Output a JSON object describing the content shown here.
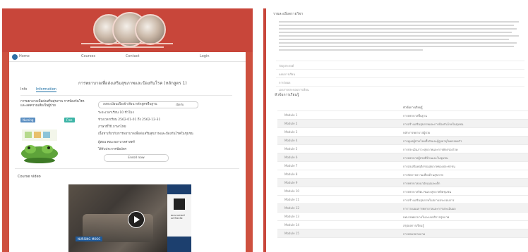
{
  "course_page": {
    "nav": [
      "Home",
      "Courses",
      "Contact",
      "Login"
    ],
    "title": "การพยาบาลเพื่อส่งเสริมสุขภาพและป้องกันโรค (หลักสูตร 1)",
    "tabs": [
      "Info",
      "Information"
    ],
    "course_title": "การพยาบาลเพื่อส่งเสริมสุขภาพ การป้องกันโรคและลดความเสี่ยงในผู้ป่วย",
    "tag_left": "Nursing",
    "tag_right": "Free",
    "info_button": "ลงทะเบียนเพื่อเข้าเรียน หลักสูตรพื้นฐาน",
    "info_badge": "เปิดรับ",
    "info_rows": [
      "ระยะเวลาเรียน 10 ชั่วโมง",
      "ช่วงเวลาเรียน 2562-01-01 ถึง 2562-12-31",
      "ภาษาที่ใช้ ภาษาไทย",
      "เนื้อหาเกี่ยวกับการพยาบาลเพื่อส่งเสริมสุขภาพและป้องกันโรคในชุมชน",
      "ผู้สอน คณะพยาบาลศาสตร์",
      "ได้รับประกาศนียบัตร"
    ],
    "enroll_button": "Enroll now",
    "section_title": "Course video",
    "video_label": "NURSING MOOC",
    "video_caption": "พยาบาลศาสตร์ มหาวิทยาลัย"
  },
  "details_page": {
    "title": "รายละเอียดรายวิชา",
    "links": [
      "วัตถุประสงค์",
      "แผนการเรียน",
      "การวัดผล",
      "เอกสารประกอบการเรียน"
    ],
    "section": "หัวข้อการเรียนรู้",
    "table_header": [
      "",
      "หัวข้อการเรียนรู้"
    ],
    "table_rows": [
      [
        "Module 1",
        "การพยาบาลพื้นฐาน"
      ],
      [
        "Module 2",
        "การสร้างเสริมสุขภาพและการป้องกันโรคในชุมชน"
      ],
      [
        "Module 3",
        "หลักการพยาบาลผู้ป่วย"
      ],
      [
        "Module 4",
        "การดูแลผู้ป่วยโรคเรื้อรังและผู้สูงอายุในครอบครัว"
      ],
      [
        "Module 5",
        "การประเมินภาวะสุขภาพและการคัดกรองโรค"
      ],
      [
        "Module 6",
        "การพยาบาลผู้ป่วยที่บ้านและในชุมชน"
      ],
      [
        "Module 7",
        "การส่งเสริมพฤติกรรมสุขภาพของประชาชน"
      ],
      [
        "Module 8",
        "การจัดการความเสี่ยงด้านสุขภาพ"
      ],
      [
        "Module 9",
        "การพยาบาลอนามัยแม่และเด็ก"
      ],
      [
        "Module 10",
        "การพยาบาลจิตเวชและสุขภาพจิตชุมชน"
      ],
      [
        "Module 11",
        "การสร้างเสริมสุขภาพในสถานประกอบการ"
      ],
      [
        "Module 12",
        "การวางแผนการพยาบาลและการประเมินผล"
      ],
      [
        "Module 13",
        "บทบาทพยาบาลในระบบบริการสุขภาพ"
      ],
      [
        "Module 14",
        "สรุปผลการเรียนรู้"
      ],
      [
        "Module 15",
        "การสอบปลายภาค"
      ]
    ]
  }
}
